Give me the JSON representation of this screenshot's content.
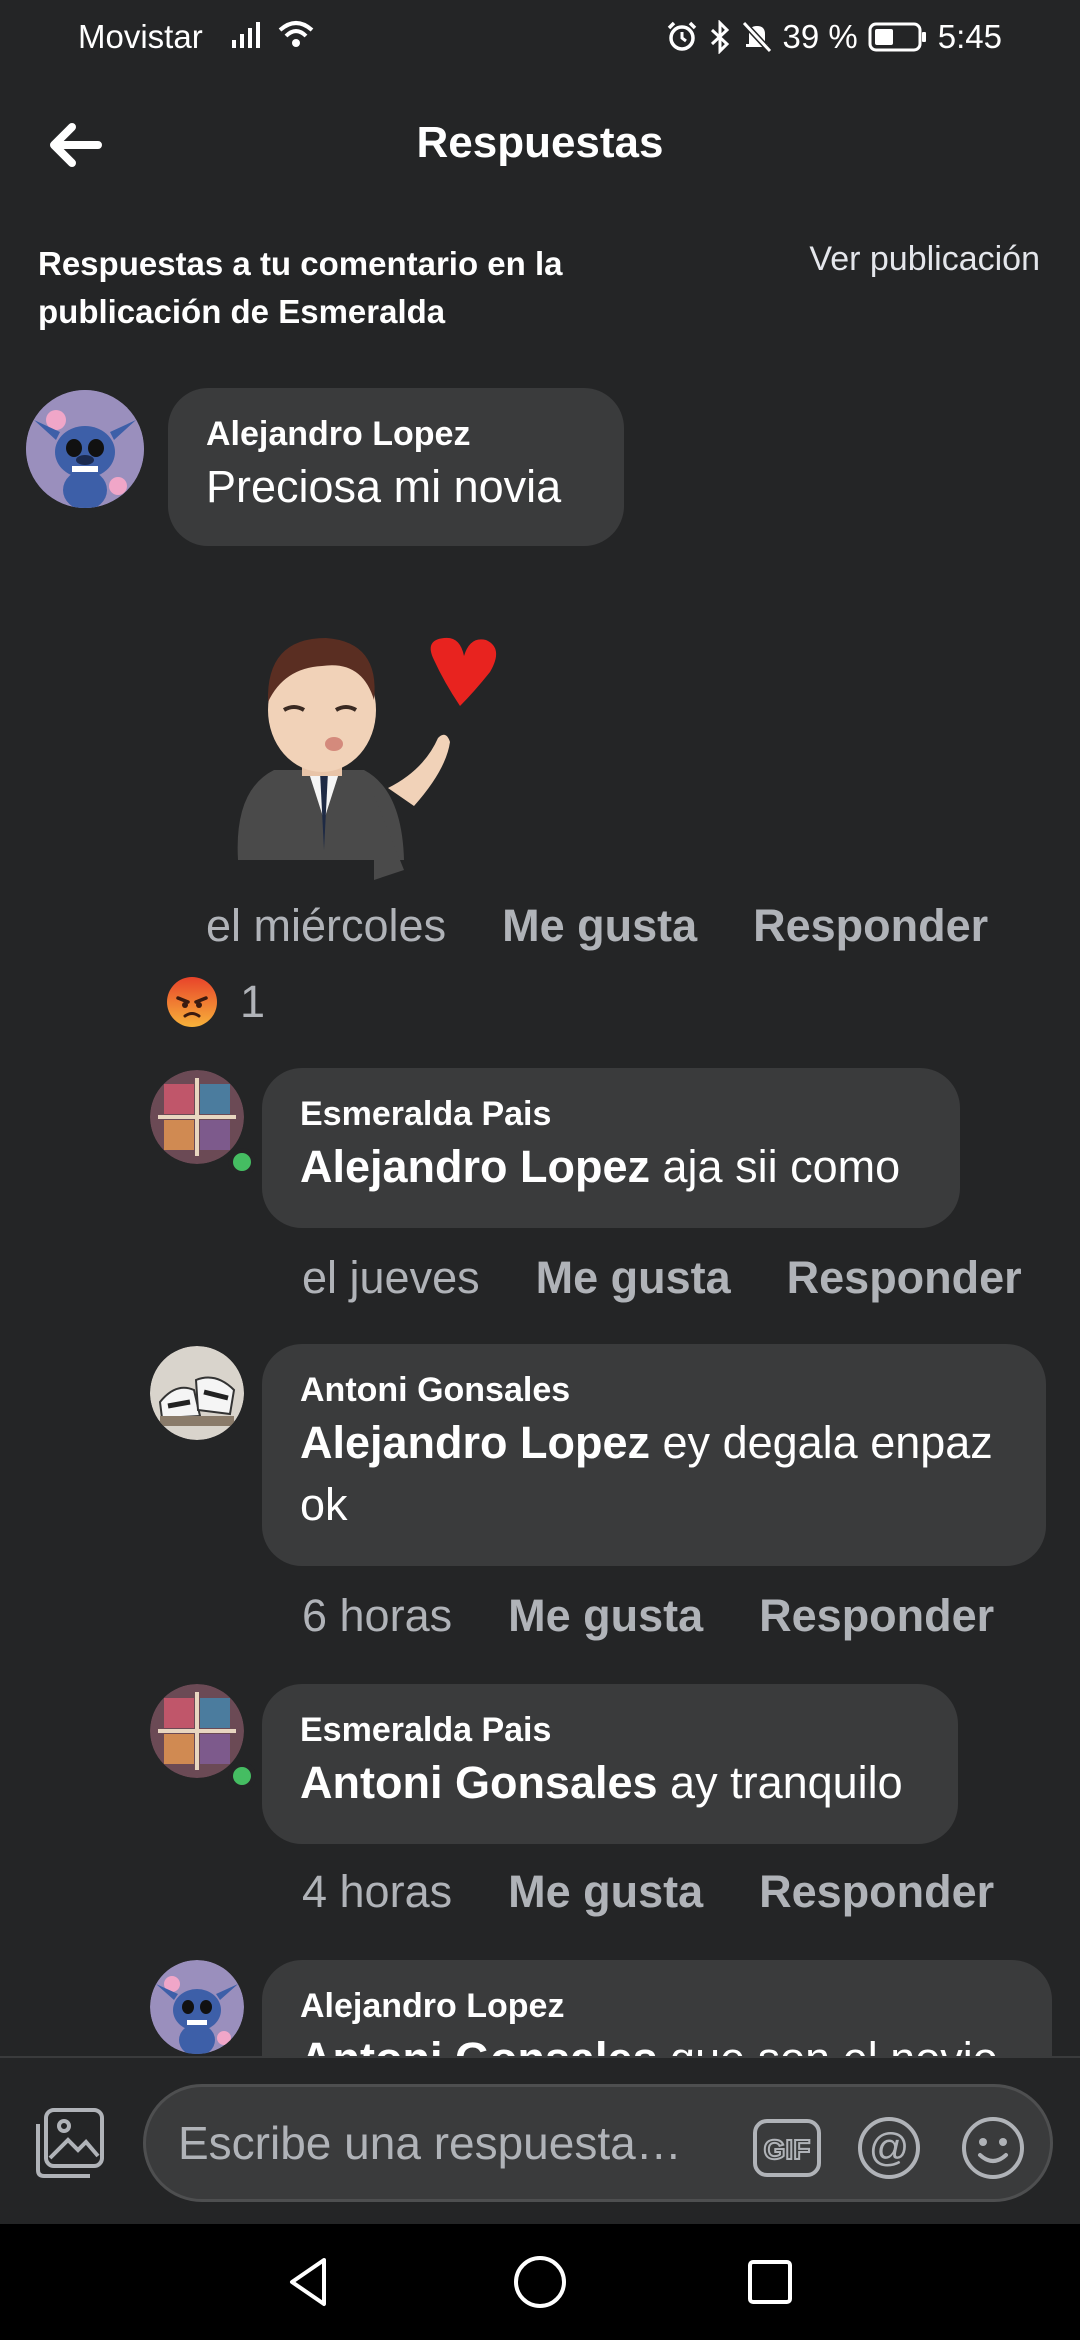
{
  "status_bar": {
    "carrier": "Movistar",
    "battery": "39 %",
    "time": "5:45"
  },
  "header": {
    "title": "Respuestas"
  },
  "context": {
    "description": "Respuestas a tu comentario en la publicación de Esmeralda",
    "view_post_label": "Ver publicación"
  },
  "original_comment": {
    "author": "Alejandro Lopez",
    "text": "Preciosa mi novia",
    "time": "el miércoles",
    "like_label": "Me gusta",
    "reply_label": "Responder",
    "reaction_count": "1",
    "reaction_icon": "angry-face-icon",
    "sticker_icon": "avatar-blowing-kiss-sticker"
  },
  "replies": [
    {
      "author": "Esmeralda Pais",
      "mention": "Alejandro Lopez",
      "text": " aja sii como",
      "time": "el jueves",
      "like_label": "Me gusta",
      "reply_label": "Responder",
      "online": true
    },
    {
      "author": "Antoni Gonsales",
      "mention": "Alejandro Lopez",
      "text": " ey degala enpaz ok",
      "time": "6 horas",
      "like_label": "Me gusta",
      "reply_label": "Responder",
      "online": false
    },
    {
      "author": "Esmeralda Pais",
      "mention": "Antoni Gonsales",
      "text": " ay tranquilo",
      "time": "4 horas",
      "like_label": "Me gusta",
      "reply_label": "Responder",
      "online": true
    },
    {
      "author": "Alejandro Lopez",
      "mention": "Antoni Gonsales",
      "text": " que son el novio",
      "online": false
    }
  ],
  "composer": {
    "placeholder": "Escribe una respuesta…",
    "gif_label": "GIF"
  },
  "colors": {
    "background": "#242526",
    "bubble": "#3a3b3c",
    "text_primary": "#ffffff",
    "text_secondary": "#b0b3b8",
    "online": "#45bd62",
    "reaction_angry": "#f36f2d"
  }
}
